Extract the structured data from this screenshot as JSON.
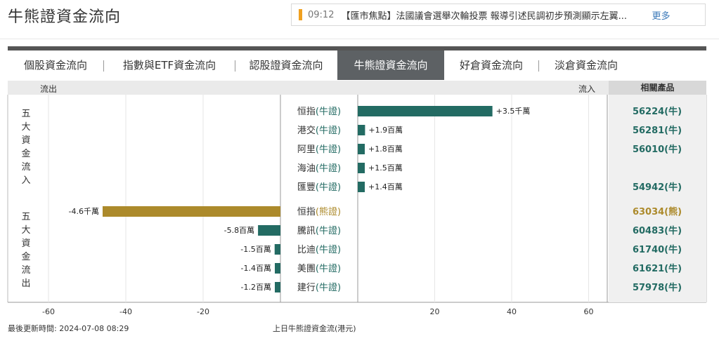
{
  "header": {
    "title": "牛熊證資金流向",
    "news": {
      "time": "09:12",
      "text": "【匯市焦點】法國議會選舉次輪投票 報導引述民調初步預測顯示左翼...",
      "more": "更多"
    }
  },
  "tabs": [
    {
      "label": "個股資金流向",
      "active": false
    },
    {
      "label": "指數與ETF資金流向",
      "active": false
    },
    {
      "label": "認股證資金流向",
      "active": false
    },
    {
      "label": "牛熊證資金流向",
      "active": true
    },
    {
      "label": "好倉資金流向",
      "active": false
    },
    {
      "label": "淡倉資金流向",
      "active": false
    }
  ],
  "table_header": {
    "outflow": "流出",
    "inflow": "流入",
    "products": "相關產品"
  },
  "group_labels": {
    "inflow": "五大資金流入",
    "outflow": "五大資金流出"
  },
  "colors": {
    "bull": "#236b63",
    "bear": "#ac8a2b",
    "active_tab": "#5d6164"
  },
  "chart_data": {
    "type": "bar",
    "orientation": "horizontal",
    "xlim": [
      -60,
      60
    ],
    "x_ticks": [
      "-60",
      "-40",
      "-20",
      "20",
      "40",
      "60"
    ],
    "xlabel": "上日牛熊證資金流(港元)",
    "inflow": [
      {
        "category": "恒指(牛證)",
        "value": 35,
        "label": "+3.5千萬",
        "product": "56224(牛)",
        "kind": "bull"
      },
      {
        "category": "港交(牛證)",
        "value": 1.9,
        "label": "+1.9百萬",
        "product": "56281(牛)",
        "kind": "bull"
      },
      {
        "category": "阿里(牛證)",
        "value": 1.8,
        "label": "+1.8百萬",
        "product": "56010(牛)",
        "kind": "bull"
      },
      {
        "category": "海油(牛證)",
        "value": 1.5,
        "label": "+1.5百萬",
        "product": "",
        "kind": "bull"
      },
      {
        "category": "匯豐(牛證)",
        "value": 1.4,
        "label": "+1.4百萬",
        "product": "54942(牛)",
        "kind": "bull"
      }
    ],
    "outflow": [
      {
        "category": "恒指(熊證)",
        "value": -46,
        "label": "-4.6千萬",
        "product": "63034(熊)",
        "kind": "bear"
      },
      {
        "category": "騰訊(牛證)",
        "value": -5.8,
        "label": "-5.8百萬",
        "product": "60483(牛)",
        "kind": "bull"
      },
      {
        "category": "比迪(牛證)",
        "value": -1.5,
        "label": "-1.5百萬",
        "product": "61740(牛)",
        "kind": "bull"
      },
      {
        "category": "美團(牛證)",
        "value": -1.4,
        "label": "-1.4百萬",
        "product": "61621(牛)",
        "kind": "bull"
      },
      {
        "category": "建行(牛證)",
        "value": -1.2,
        "label": "-1.2百萬",
        "product": "57978(牛)",
        "kind": "bull"
      }
    ]
  },
  "footer": {
    "updated": "最後更新時間: 2024-07-08 08:29",
    "caption": "上日牛熊證資金流(港元)"
  }
}
